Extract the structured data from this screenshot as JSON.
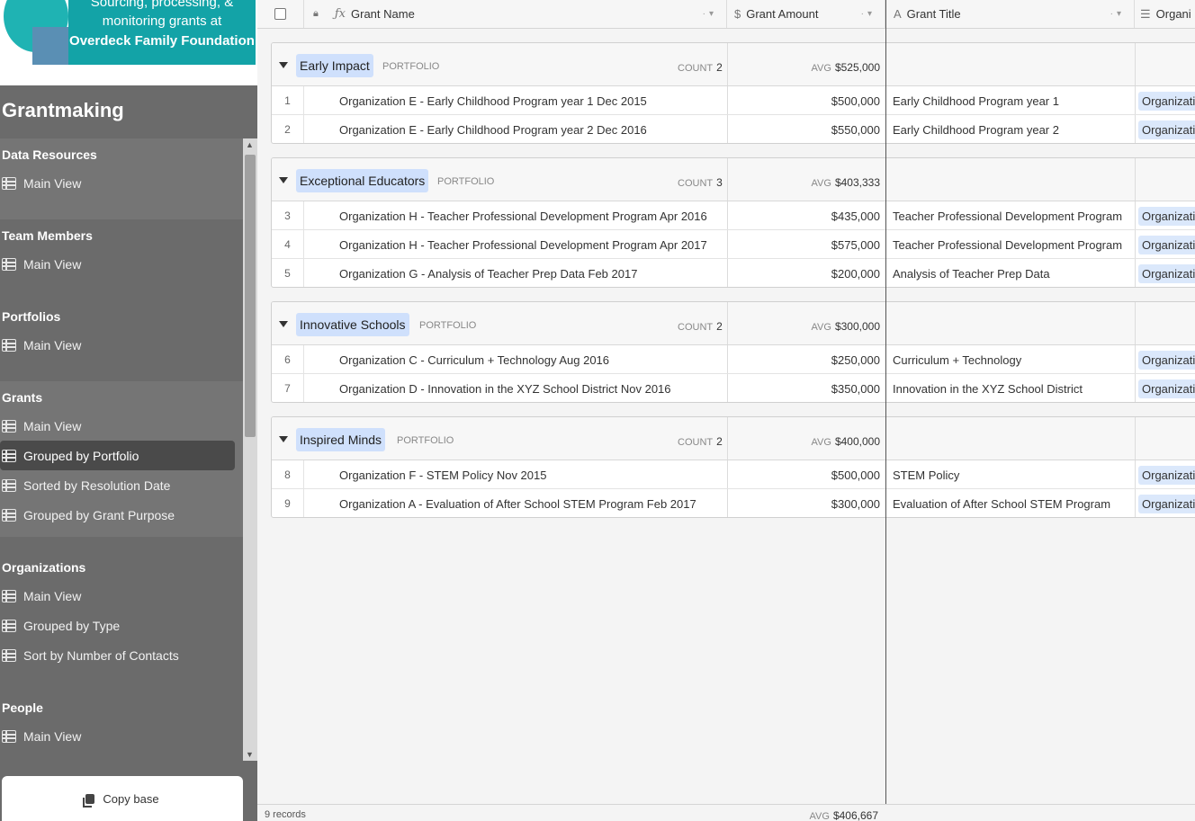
{
  "logo": {
    "line1": "Sourcing, processing, &",
    "line2": "monitoring grants at",
    "line3": "Overdeck Family Foundation"
  },
  "base_title": "Grantmaking",
  "sidebar": {
    "sections": [
      {
        "title": "Data Resources",
        "items": [
          {
            "label": "Main View"
          }
        ]
      },
      {
        "title": "Team Members",
        "items": [
          {
            "label": "Main View"
          }
        ]
      },
      {
        "title": "Portfolios",
        "items": [
          {
            "label": "Main View"
          }
        ]
      },
      {
        "title": "Grants",
        "items": [
          {
            "label": "Main View"
          },
          {
            "label": "Grouped by Portfolio",
            "active": true
          },
          {
            "label": "Sorted by Resolution Date"
          },
          {
            "label": "Grouped by Grant Purpose"
          }
        ]
      },
      {
        "title": "Organizations",
        "items": [
          {
            "label": "Main View"
          },
          {
            "label": "Grouped by Type"
          },
          {
            "label": "Sort by Number of Contacts"
          }
        ]
      },
      {
        "title": "People",
        "items": [
          {
            "label": "Main View"
          }
        ]
      }
    ],
    "copy_base_label": "Copy base"
  },
  "columns": {
    "grant_name": "Grant Name",
    "grant_amount": "Grant Amount",
    "grant_title": "Grant Title",
    "organization": "Organi"
  },
  "group_field_label": "PORTFOLIO",
  "count_label": "COUNT",
  "avg_label": "AVG",
  "groups": [
    {
      "name": "Early Impact",
      "count": "2",
      "avg": "$525,000",
      "rows": [
        {
          "num": "1",
          "name": "Organization E - Early Childhood Program year 1 Dec 2015",
          "amount": "$500,000",
          "title": "Early Childhood Program year 1",
          "org": "Organizati"
        },
        {
          "num": "2",
          "name": "Organization E - Early Childhood Program year 2 Dec 2016",
          "amount": "$550,000",
          "title": "Early Childhood Program year 2",
          "org": "Organizati"
        }
      ]
    },
    {
      "name": "Exceptional Educators",
      "count": "3",
      "avg": "$403,333",
      "rows": [
        {
          "num": "3",
          "name": "Organization H - Teacher Professional Development Program Apr 2016",
          "amount": "$435,000",
          "title": "Teacher Professional Development Program",
          "org": "Organizati"
        },
        {
          "num": "4",
          "name": "Organization H - Teacher Professional Development Program Apr 2017",
          "amount": "$575,000",
          "title": "Teacher Professional Development Program",
          "org": "Organizati"
        },
        {
          "num": "5",
          "name": "Organization G - Analysis of Teacher Prep Data Feb 2017",
          "amount": "$200,000",
          "title": "Analysis of Teacher Prep Data",
          "org": "Organizati"
        }
      ]
    },
    {
      "name": "Innovative Schools",
      "count": "2",
      "avg": "$300,000",
      "rows": [
        {
          "num": "6",
          "name": "Organization C - Curriculum + Technology Aug 2016",
          "amount": "$250,000",
          "title": "Curriculum + Technology",
          "org": "Organizati"
        },
        {
          "num": "7",
          "name": "Organization D - Innovation in the XYZ School District Nov 2016",
          "amount": "$350,000",
          "title": "Innovation in the XYZ School District",
          "org": "Organizati"
        }
      ]
    },
    {
      "name": "Inspired Minds",
      "count": "2",
      "avg": "$400,000",
      "rows": [
        {
          "num": "8",
          "name": "Organization F - STEM Policy Nov 2015",
          "amount": "$500,000",
          "title": "STEM Policy",
          "org": "Organizati"
        },
        {
          "num": "9",
          "name": "Organization A - Evaluation of After School STEM Program Feb 2017",
          "amount": "$300,000",
          "title": "Evaluation of After School STEM Program",
          "org": "Organizati"
        }
      ]
    }
  ],
  "footer": {
    "records": "9 records",
    "avg_label": "AVG",
    "avg_value": "$406,667"
  },
  "colors": {
    "sidebar_bg": "#6b6b6b",
    "active_item_bg": "#4a4a4a",
    "group_pill_bg": "#cfe0fc",
    "logo_teal": "#13a3a7"
  }
}
